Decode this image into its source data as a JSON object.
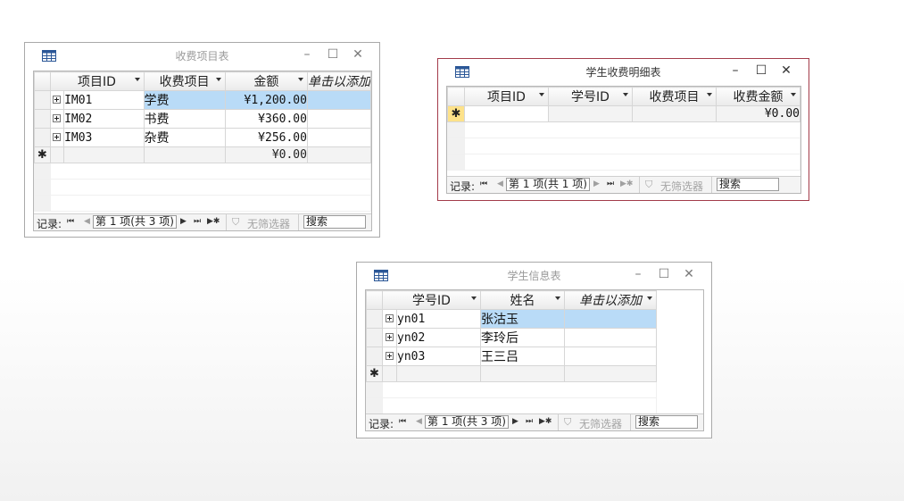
{
  "windows": {
    "fee_items": {
      "title": "收费项目表",
      "columns": [
        "项目ID",
        "收费项目",
        "金额",
        "单击以添加"
      ],
      "rows": [
        {
          "id": "IM01",
          "name": "学费",
          "amount": "¥1,200.00"
        },
        {
          "id": "IM02",
          "name": "书费",
          "amount": "¥360.00"
        },
        {
          "id": "IM03",
          "name": "杂费",
          "amount": "¥256.00"
        }
      ],
      "new_row_amount": "¥0.00",
      "nav": {
        "label": "记录:",
        "position": "第 1 项(共 3 项)",
        "filter": "无筛选器",
        "search": "搜索"
      }
    },
    "student_fee_detail": {
      "title": "学生收费明细表",
      "columns": [
        "项目ID",
        "学号ID",
        "收费项目",
        "收费金额"
      ],
      "new_row_amount": "¥0.00",
      "nav": {
        "label": "记录:",
        "position": "第 1 项(共 1 项)",
        "filter": "无筛选器",
        "search": "搜索"
      }
    },
    "student_info": {
      "title": "学生信息表",
      "columns": [
        "学号ID",
        "姓名",
        "单击以添加"
      ],
      "rows": [
        {
          "id": "yn01",
          "name": "张沽玉"
        },
        {
          "id": "yn02",
          "name": "李玲后"
        },
        {
          "id": "yn03",
          "name": "王三吕"
        }
      ],
      "nav": {
        "label": "记录:",
        "position": "第 1 项(共 3 项)",
        "filter": "无筛选器",
        "search": "搜索"
      }
    }
  },
  "glyphs": {
    "minimize": "–",
    "maximize": "☐",
    "close": "✕",
    "new_record": "✱",
    "first": "⏮",
    "prev": "◀",
    "next": "▶",
    "last": "⏭",
    "new_nav": "▶✱"
  },
  "colors": {
    "active_border": "#a33b4a",
    "selection": "#b9dbf7",
    "header_selected": "#f6c343"
  }
}
